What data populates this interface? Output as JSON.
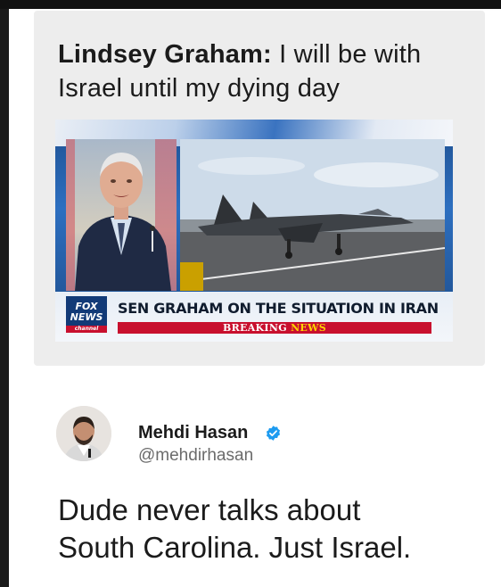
{
  "quote": {
    "headline_bold": "Lindsey Graham:",
    "headline_rest": " I will be with Israel until my dying day"
  },
  "broadcast": {
    "logo_line1": "FOX",
    "logo_line2": "NEWS",
    "logo_small": "channel",
    "chyron": "SEN GRAHAM ON THE SITUATION IN IRAN",
    "breaking_1": "BREAKING",
    "breaking_2": "NEWS"
  },
  "author": {
    "name": "Mehdi Hasan",
    "handle": "@mehdirhasan",
    "verified_icon": "verified-badge-icon",
    "verified_color": "#1d9bf0"
  },
  "tweet": {
    "line1": "Dude never talks about",
    "line2": "South Carolina. Just Israel."
  }
}
